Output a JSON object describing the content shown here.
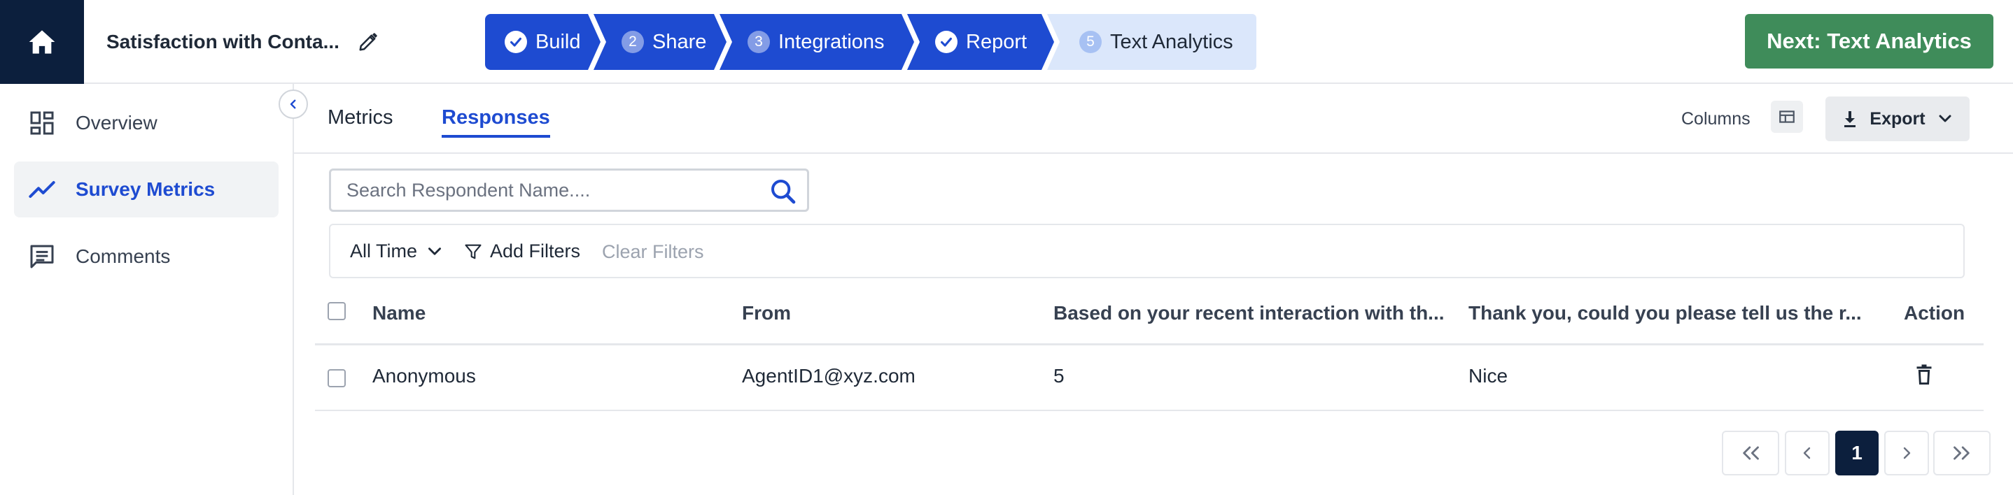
{
  "header": {
    "survey_title": "Satisfaction with Conta...",
    "steps": [
      {
        "label": "Build",
        "status": "done",
        "marker": ""
      },
      {
        "label": "Share",
        "status": "done",
        "marker": "2"
      },
      {
        "label": "Integrations",
        "status": "done",
        "marker": "3"
      },
      {
        "label": "Report",
        "status": "done",
        "marker": ""
      },
      {
        "label": "Text Analytics",
        "status": "todo",
        "marker": "5"
      }
    ],
    "next_label": "Next: Text Analytics"
  },
  "sidebar": {
    "items": [
      {
        "label": "Overview",
        "icon": "dashboard-icon",
        "active": false
      },
      {
        "label": "Survey Metrics",
        "icon": "trending-line-icon",
        "active": true
      },
      {
        "label": "Comments",
        "icon": "comment-icon",
        "active": false
      }
    ]
  },
  "tabs": [
    {
      "label": "Metrics",
      "active": false
    },
    {
      "label": "Responses",
      "active": true
    }
  ],
  "toolbar": {
    "columns_label": "Columns",
    "export_label": "Export"
  },
  "search": {
    "placeholder": "Search Respondent Name....",
    "value": ""
  },
  "filters": {
    "time_label": "All Time",
    "add_label": "Add Filters",
    "clear_label": "Clear Filters"
  },
  "table": {
    "headers": [
      "Name",
      "From",
      "Based on your recent interaction with th...",
      "Thank you, could you please tell us the r...",
      "Action"
    ],
    "rows": [
      [
        "Anonymous",
        "AgentID1@xyz.com",
        "5",
        "Nice"
      ]
    ]
  },
  "pagination": {
    "current_page": "1"
  },
  "colors": {
    "primary": "#1e4bd1",
    "navy": "#0c1f3d",
    "success": "#3f8c5a",
    "step_pending": "#dbe7fb"
  }
}
